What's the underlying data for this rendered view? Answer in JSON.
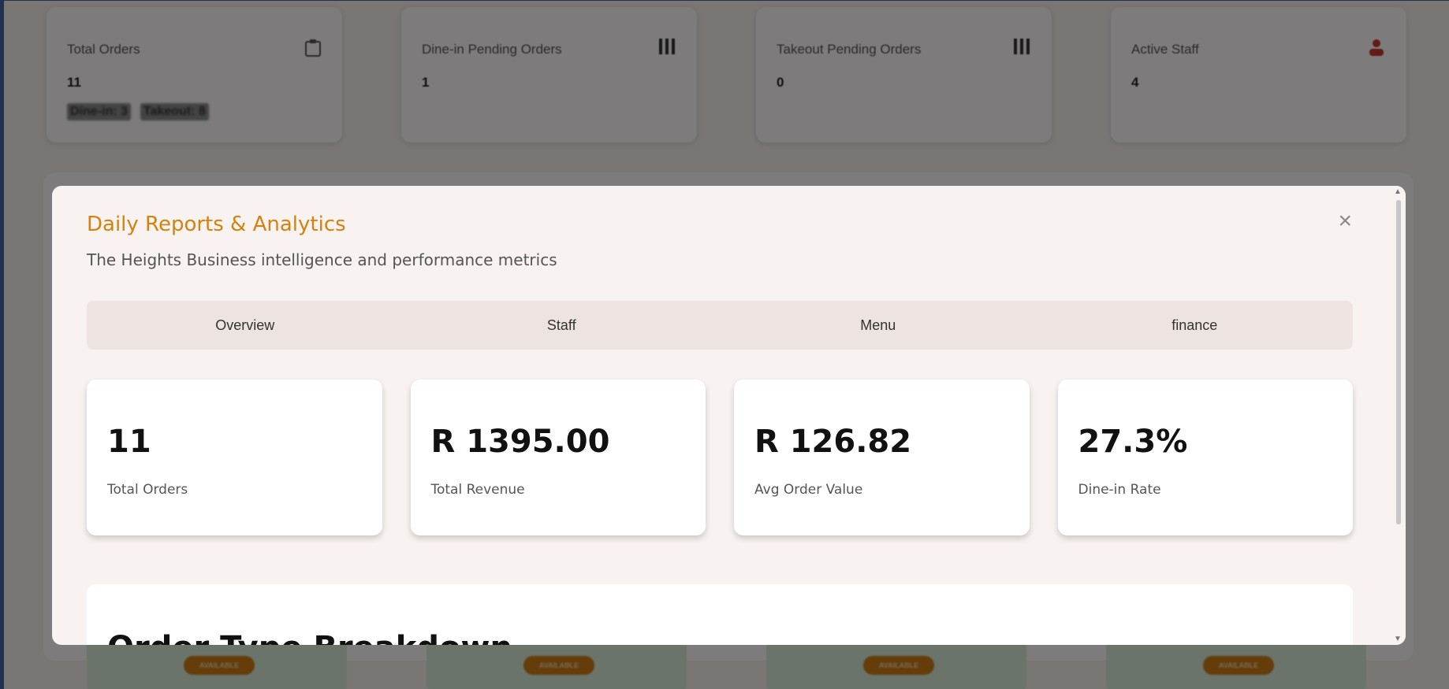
{
  "dashboard": {
    "stat_cards": [
      {
        "title": "Total Orders",
        "value": "11",
        "chips": [
          "Dine-in: 3",
          "Takeout: 8"
        ],
        "icon": "clipboard-icon"
      },
      {
        "title": "Dine-in Pending Orders",
        "value": "1",
        "icon": "bars-icon"
      },
      {
        "title": "Takeout Pending Orders",
        "value": "0",
        "icon": "bars-icon"
      },
      {
        "title": "Active Staff",
        "value": "4",
        "icon": "staff-icon"
      }
    ],
    "table_badges": [
      "AVAILABLE",
      "AVAILABLE",
      "AVAILABLE",
      "AVAILABLE"
    ]
  },
  "modal": {
    "title": "Daily Reports & Analytics",
    "subtitle": "The Heights Business intelligence and performance metrics",
    "close_label": "×",
    "tabs": [
      {
        "label": "Overview"
      },
      {
        "label": "Staff"
      },
      {
        "label": "Menu"
      },
      {
        "label": "finance"
      }
    ],
    "metrics": [
      {
        "value": "11",
        "label": "Total Orders"
      },
      {
        "value": "R 1395.00",
        "label": "Total Revenue"
      },
      {
        "value": "R 126.82",
        "label": "Avg Order Value"
      },
      {
        "value": "27.3%",
        "label": "Dine-in Rate"
      }
    ],
    "breakdown_title": "Order Type Breakdown"
  },
  "colors": {
    "accent": "#d4820f",
    "frame": "#22314d"
  }
}
